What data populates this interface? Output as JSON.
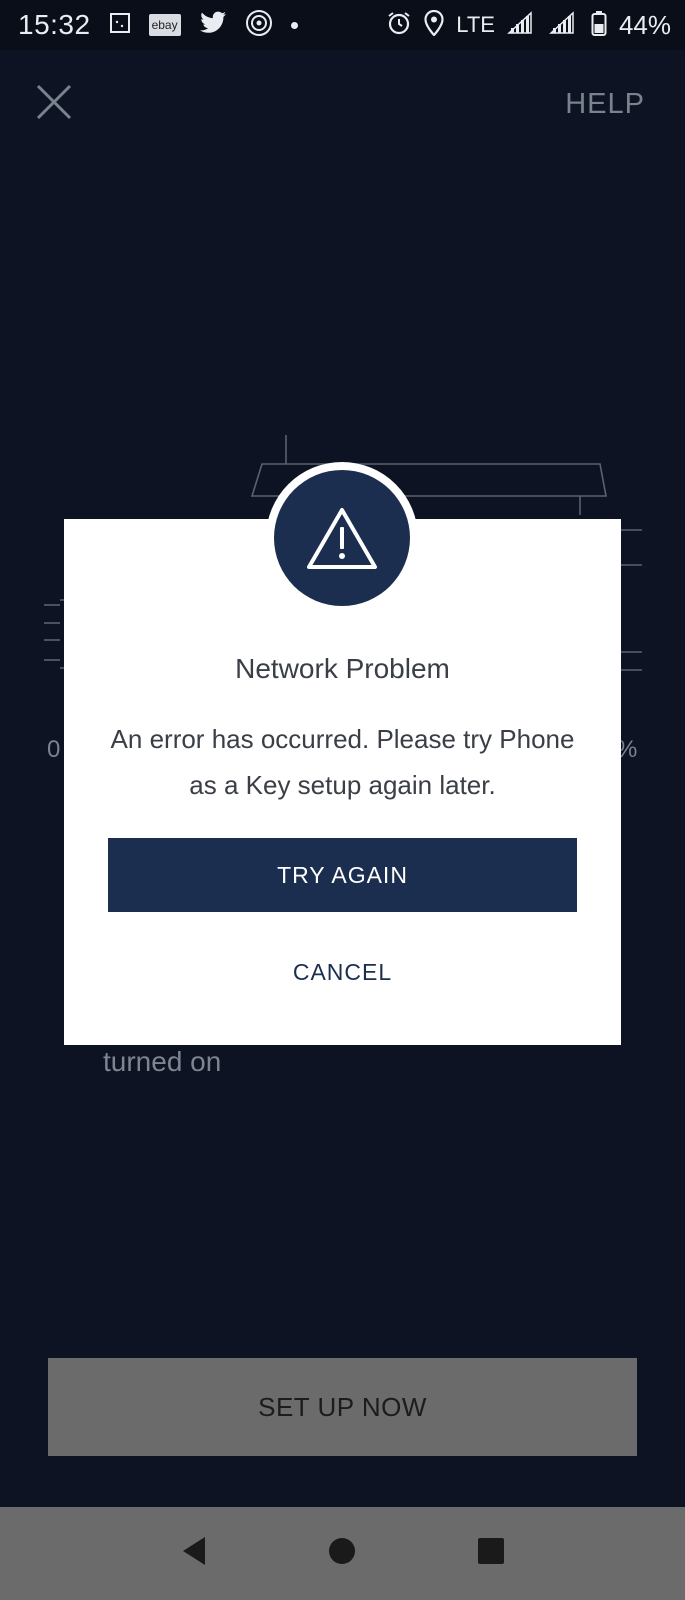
{
  "status_bar": {
    "time": "15:32",
    "ebay_badge": "ebay",
    "network": "LTE",
    "battery": "44%",
    "icons": [
      "screenshot-icon",
      "ebay-icon",
      "twitter-icon",
      "hotspot-icon",
      "notification-dot-icon",
      "alarm-icon",
      "location-icon",
      "signal-icon",
      "signal-icon",
      "battery-icon"
    ]
  },
  "header": {
    "help_label": "HELP"
  },
  "background": {
    "percent_left": "0",
    "percent_right": "%",
    "turned_on_text": "turned on",
    "setup_button_label": "SET UP NOW"
  },
  "dialog": {
    "icon": "warning-icon",
    "title": "Network Problem",
    "message": "An error has occurred. Please try Phone as a Key setup again later.",
    "primary_label": "TRY AGAIN",
    "secondary_label": "CANCEL"
  },
  "navbar": {
    "icons": [
      "back-icon",
      "home-icon",
      "recents-icon"
    ]
  },
  "colors": {
    "dialog_accent": "#1c2e4f",
    "background": "#0d1322",
    "overlay_button": "#6b6b6b"
  }
}
